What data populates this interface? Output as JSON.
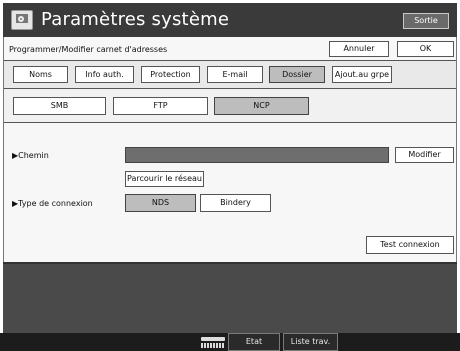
{
  "header": {
    "title": "Paramètres système",
    "exit_label": "Sortie"
  },
  "subheader": {
    "title": "Programmer/Modifier carnet d'adresses",
    "cancel_label": "Annuler",
    "ok_label": "OK"
  },
  "tabs": [
    {
      "label": "Noms",
      "selected": false
    },
    {
      "label": "Info auth.",
      "selected": false
    },
    {
      "label": "Protection",
      "selected": false
    },
    {
      "label": "E-mail",
      "selected": false
    },
    {
      "label": "Dossier",
      "selected": true
    },
    {
      "label": "Ajout.au grpe",
      "selected": false
    }
  ],
  "protocols": [
    {
      "label": "SMB",
      "selected": false
    },
    {
      "label": "FTP",
      "selected": false
    },
    {
      "label": "NCP",
      "selected": true
    }
  ],
  "path": {
    "label": "▶Chemin",
    "value": "",
    "modify_label": "Modifier",
    "browse_label": "Parcourir le réseau"
  },
  "connection": {
    "label": "▶Type de connexion",
    "options": [
      {
        "label": "NDS",
        "selected": true
      },
      {
        "label": "Bindery",
        "selected": false
      }
    ],
    "test_label": "Test connexion"
  },
  "status_bar": {
    "system_status_label": "Etat système",
    "job_list_label": "Liste trav."
  },
  "colors": {
    "header_bg": "#3a3a3a",
    "selected_button": "#bdbdbd",
    "path_field": "#6e6e6e",
    "bottom_area": "#4a4a4a"
  }
}
